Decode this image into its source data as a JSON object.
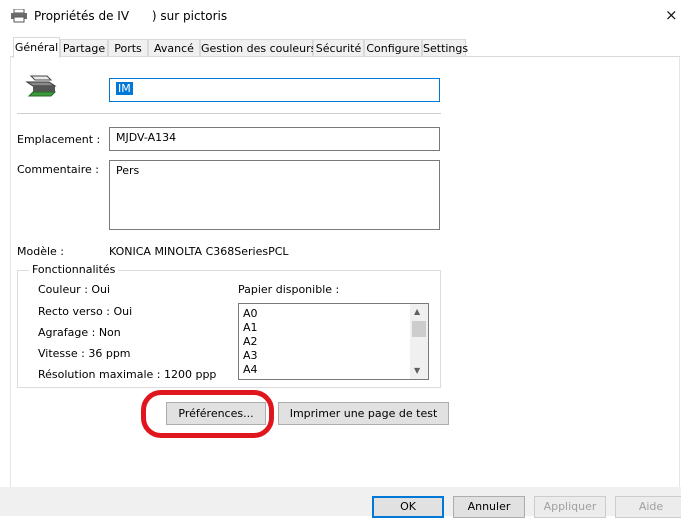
{
  "window": {
    "title": "Propriétés de IV      ) sur pictoris",
    "icons": {
      "app": "printer-icon",
      "close": "close-icon"
    },
    "close_glyph": "×"
  },
  "tabs": [
    {
      "label": "Général",
      "active": true
    },
    {
      "label": "Partage"
    },
    {
      "label": "Ports"
    },
    {
      "label": "Avancé"
    },
    {
      "label": "Gestion des couleurs"
    },
    {
      "label": "Sécurité"
    },
    {
      "label": "Configure"
    },
    {
      "label": "Settings"
    }
  ],
  "general": {
    "printer_name": "IM",
    "location_label": "Emplacement :",
    "location_value": "MJDV-A134",
    "comment_label": "Commentaire :",
    "comment_value": "Pers",
    "model_label": "Modèle :",
    "model_value": "KONICA MINOLTA C368SeriesPCL",
    "features": {
      "title": "Fonctionnalités",
      "color": "Couleur : Oui",
      "duplex": "Recto verso : Oui",
      "staple": "Agrafage : Non",
      "speed": "Vitesse : 36 ppm",
      "resolution": "Résolution maximale : 1200 ppp",
      "paper_label": "Papier disponible :",
      "paper_options": [
        "A0",
        "A1",
        "A2",
        "A3",
        "A4"
      ]
    },
    "preferences_button": "Préférences...",
    "test_page_button": "Imprimer une page de test"
  },
  "footer": {
    "ok": "OK",
    "cancel": "Annuler",
    "apply": "Appliquer",
    "help": "Aide"
  },
  "colors": {
    "accent": "#0078d7",
    "highlight": "#e0161e"
  }
}
